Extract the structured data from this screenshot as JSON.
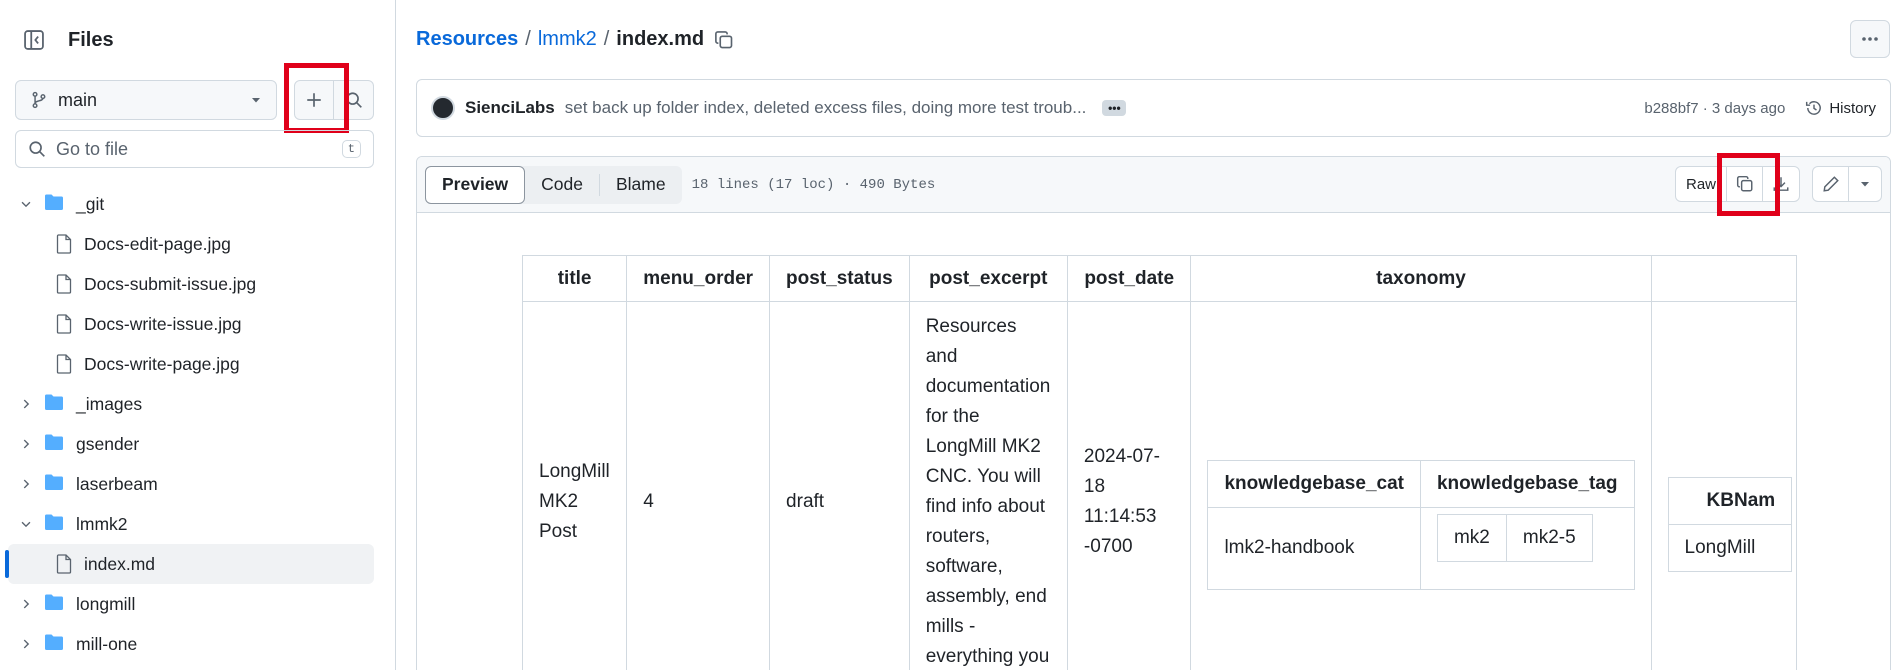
{
  "sidebar": {
    "title": "Files",
    "branch": "main",
    "goto_placeholder": "Go to file",
    "goto_shortcut": "t",
    "tree": [
      {
        "type": "folder",
        "name": "_git",
        "expanded": true
      },
      {
        "type": "file",
        "name": "Docs-edit-page.jpg"
      },
      {
        "type": "file",
        "name": "Docs-submit-issue.jpg"
      },
      {
        "type": "file",
        "name": "Docs-write-issue.jpg"
      },
      {
        "type": "file",
        "name": "Docs-write-page.jpg"
      },
      {
        "type": "folder",
        "name": "_images",
        "expanded": false
      },
      {
        "type": "folder",
        "name": "gsender",
        "expanded": false
      },
      {
        "type": "folder",
        "name": "laserbeam",
        "expanded": false
      },
      {
        "type": "folder",
        "name": "lmmk2",
        "expanded": true
      },
      {
        "type": "file",
        "name": "index.md",
        "selected": true
      },
      {
        "type": "folder",
        "name": "longmill",
        "expanded": false
      },
      {
        "type": "folder",
        "name": "mill-one",
        "expanded": false
      }
    ]
  },
  "breadcrumb": {
    "root": "Resources",
    "folder": "lmmk2",
    "file": "index.md",
    "sep": "/"
  },
  "commit": {
    "author": "SienciLabs",
    "message": "set back up folder index, deleted excess files, doing more test troub...",
    "meta": "b288bf7 · 3 days ago",
    "history_label": "History"
  },
  "toolbar": {
    "tabs": [
      "Preview",
      "Code",
      "Blame"
    ],
    "active_tab": "Preview",
    "file_meta": "18 lines (17 loc) · 490 Bytes",
    "raw_label": "Raw"
  },
  "frontmatter": {
    "headers": [
      "title",
      "menu_order",
      "post_status",
      "post_excerpt",
      "post_date",
      "taxonomy"
    ],
    "title": "LongMill MK2 Post",
    "menu_order": "4",
    "post_status": "draft",
    "post_excerpt": "Resources and documentation for the LongMill MK2 CNC. You will find info about routers, software, assembly, end mills - everything you need to get",
    "post_date": "2024-07-18 11:14:53 -0700",
    "taxonomy": {
      "headers": [
        "knowledgebase_cat",
        "knowledgebase_tag"
      ],
      "cat": "lmk2-handbook",
      "tags": [
        "mk2",
        "mk2-5"
      ]
    },
    "extra": {
      "header": "KBNam",
      "value": "LongMill"
    }
  },
  "highlight_color": "#e0001a",
  "accent_color": "#0969da",
  "folder_color": "#54aeff"
}
